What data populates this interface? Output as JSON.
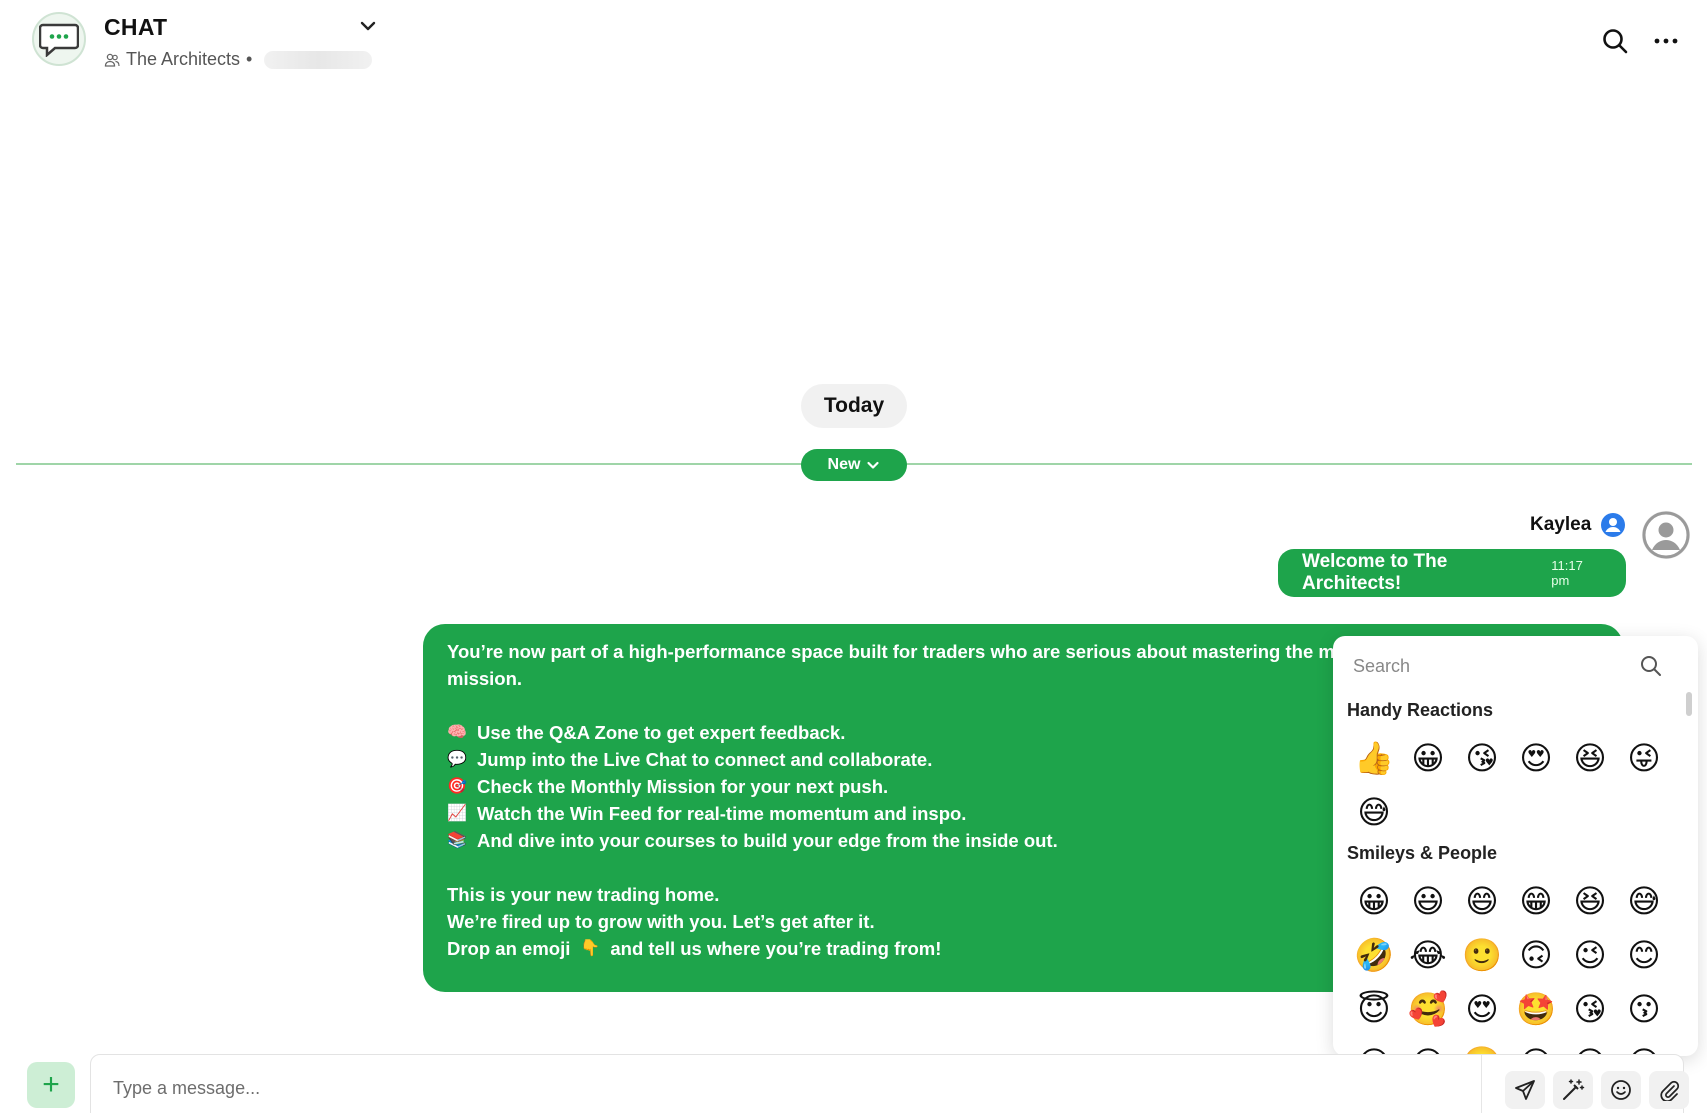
{
  "header": {
    "title": "CHAT",
    "group_name": "The Architects",
    "separator": "•"
  },
  "divider": {
    "today_label": "Today",
    "new_label": "New"
  },
  "message": {
    "sender": "Kaylea",
    "short_text": "Welcome to The Architects!",
    "time": "11:17 pm",
    "long": {
      "intro_1": "You’re now part of a high-performance space built for traders who are serious about mastering the marke",
      "intro_2": "mission.",
      "items": [
        {
          "emoji": "🧠",
          "text": "Use the Q&A Zone to get expert feedback."
        },
        {
          "emoji": "💬",
          "text": "Jump into the Live Chat to connect and collaborate."
        },
        {
          "emoji": "🎯",
          "text": "Check the Monthly Mission for your next push."
        },
        {
          "emoji": "📈",
          "text": "Watch the Win Feed for real-time momentum and inspo."
        },
        {
          "emoji": "📚",
          "text": "And dive into your courses to build your edge from the inside out."
        }
      ],
      "outro_1": "This is your new trading home.",
      "outro_2": "We’re fired up to grow with you. Let’s get after it.",
      "outro_3_a": "Drop an emoji",
      "outro_3_emoji": "👇",
      "outro_3_b": "and tell us where you’re trading from!"
    }
  },
  "picker": {
    "search_placeholder": "Search",
    "sections": [
      {
        "title": "Handy Reactions",
        "emojis": [
          "👍",
          "😀",
          "😘",
          "😍",
          "😆",
          "😜",
          "😅"
        ]
      },
      {
        "title": "Smileys & People",
        "emojis": [
          "😀",
          "😃",
          "😄",
          "😁",
          "😆",
          "😅",
          "🤣",
          "😂",
          "🙂",
          "🙃",
          "😉",
          "😊",
          "😇",
          "🥰",
          "😍",
          "🤩",
          "😘",
          "😗",
          "😚",
          "😙",
          "🥲",
          "😋",
          "😛",
          "😜"
        ]
      }
    ]
  },
  "composer": {
    "placeholder": "Type a message...",
    "add_label": "+"
  },
  "colors": {
    "accent": "#1ea44b",
    "accent_light": "#cdeed5",
    "divider_line": "#9fd5a8",
    "pill_bg": "#f1f1f1"
  }
}
